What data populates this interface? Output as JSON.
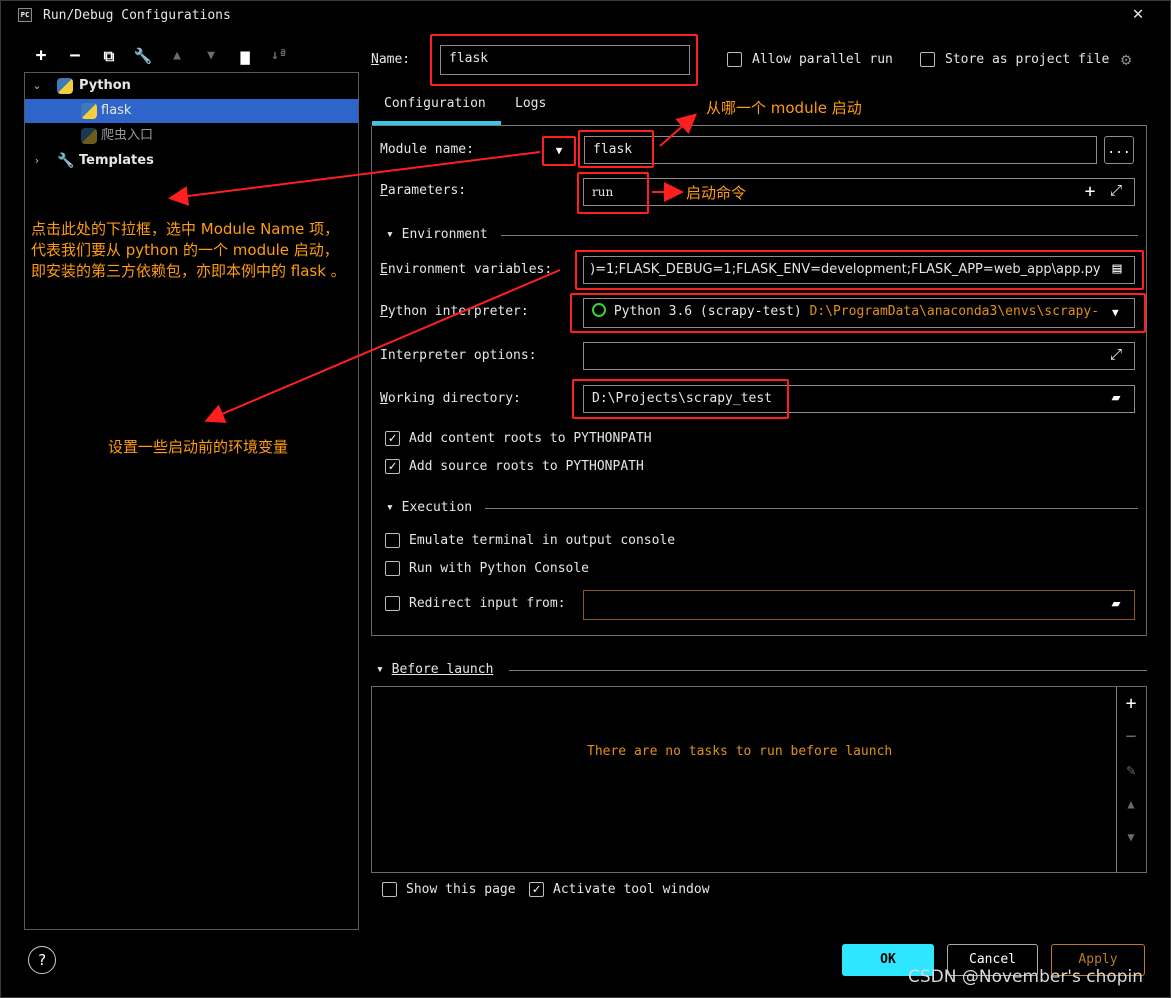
{
  "window": {
    "title": "Run/Debug Configurations",
    "app_icon": "PC",
    "close": "✕"
  },
  "tree": {
    "python_group": "Python",
    "items": [
      {
        "label": "flask",
        "selected": true
      },
      {
        "label": "爬虫入口",
        "selected": false
      }
    ],
    "templates": "Templates"
  },
  "name": {
    "label": "Name:",
    "value": "flask"
  },
  "options": {
    "allow_parallel": {
      "label": "Allow parallel run",
      "checked": false
    },
    "store_project_file": {
      "label": "Store as project file",
      "checked": false
    }
  },
  "tabs": [
    {
      "label": "Configuration",
      "active": true
    },
    {
      "label": "Logs",
      "active": false
    }
  ],
  "form": {
    "module_name": {
      "label": "Module name:",
      "value": "flask"
    },
    "parameters": {
      "label": "Parameters:",
      "value": "run"
    },
    "environment_section": "Environment",
    "env_vars": {
      "label": "Environment variables:",
      "value": ")=1;FLASK_DEBUG=1;FLASK_ENV=development;FLASK_APP=web_app\\app.py"
    },
    "interpreter": {
      "label": "Python interpreter:",
      "name": "Python 3.6 (scrapy-test)",
      "path": "D:\\ProgramData\\anaconda3\\envs\\scrapy-"
    },
    "interpreter_options": {
      "label": "Interpreter options:",
      "value": ""
    },
    "working_dir": {
      "label": "Working directory:",
      "value": "D:\\Projects\\scrapy_test"
    },
    "add_content_roots": {
      "label": "Add content roots to PYTHONPATH",
      "checked": true
    },
    "add_source_roots": {
      "label": "Add source roots to PYTHONPATH",
      "checked": true
    },
    "execution_section": "Execution",
    "emulate_terminal": {
      "label": "Emulate terminal in output console",
      "checked": false
    },
    "python_console": {
      "label": "Run with Python Console",
      "checked": false
    },
    "redirect_input": {
      "label": "Redirect input from:",
      "checked": false,
      "value": ""
    }
  },
  "before_launch": {
    "section": "Before launch",
    "empty_text": "There are no tasks to run before launch"
  },
  "footer": {
    "show_page": {
      "label": "Show this page",
      "checked": false
    },
    "activate_tool": {
      "label": "Activate tool window",
      "checked": true
    },
    "help": "?",
    "ok": "OK",
    "cancel": "Cancel",
    "apply": "Apply"
  },
  "annotations": {
    "module": "从哪一个 module 启动",
    "command": "启动命令",
    "dropdown_line1": "点击此处的下拉框，选中 Module Name 项，",
    "dropdown_line2": "代表我们要从 python 的一个 module 启动，",
    "dropdown_line3": "即安装的第三方依赖包，亦即本例中的 flask 。",
    "env": "设置一些启动前的环境变量"
  },
  "watermark": "CSDN @November's  chopin",
  "colors": {
    "accent": "#2ee6ff",
    "annotation": "#ff9c0f",
    "highlight": "#ff1f1f",
    "selection": "#2f65ca"
  }
}
